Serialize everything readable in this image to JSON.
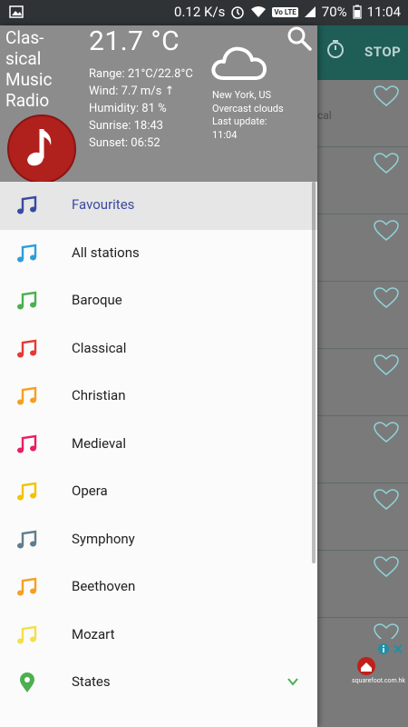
{
  "status_bar": {
    "network_speed": "0.12 K/s",
    "volte": "Vo LTE",
    "battery": "70%",
    "time": "11:04"
  },
  "background_app": {
    "stop_label": "STOP",
    "row_snippet": "cal"
  },
  "ad": {
    "brand": "squarefoot.com.hk"
  },
  "drawer": {
    "app_title": "Clas- sical Music Radio",
    "weather": {
      "temperature": "21.7 °C",
      "range": "Range: 21°C/22.8°C",
      "wind": "Wind: 7.7 m/s ↑",
      "humidity": "Humidity: 81 %",
      "sunrise": "Sunrise: 18:43",
      "sunset": "Sunset: 06:52",
      "location": "New York, US",
      "condition": "Overcast clouds",
      "last_update_label": "Last update:",
      "last_update_time": "11:04"
    },
    "menu": [
      {
        "label": "Favourites",
        "color": "#3a4aa0"
      },
      {
        "label": "All stations",
        "color": "#2f9ed8"
      },
      {
        "label": "Baroque",
        "color": "#4caf50"
      },
      {
        "label": "Classical",
        "color": "#e53935"
      },
      {
        "label": "Christian",
        "color": "#f5a020"
      },
      {
        "label": "Medieval",
        "color": "#e91e63"
      },
      {
        "label": "Opera",
        "color": "#f2c400"
      },
      {
        "label": "Symphony",
        "color": "#607d8b"
      },
      {
        "label": "Beethoven",
        "color": "#f5a020"
      },
      {
        "label": "Mozart",
        "color": "#f2e04a"
      },
      {
        "label": "States",
        "color": "#4caf50"
      }
    ]
  },
  "colors": {
    "header_bg": "#8c8c8c",
    "toolbar_bg": "#1f5d57",
    "accent_heart": "#8fd3d8"
  },
  "icons": {
    "search": "search-icon",
    "cloud": "cloud-icon",
    "timer": "timer-icon",
    "heart": "heart-icon",
    "note": "music-note-icon",
    "pin": "location-pin-icon",
    "chevron": "chevron-down-icon"
  }
}
